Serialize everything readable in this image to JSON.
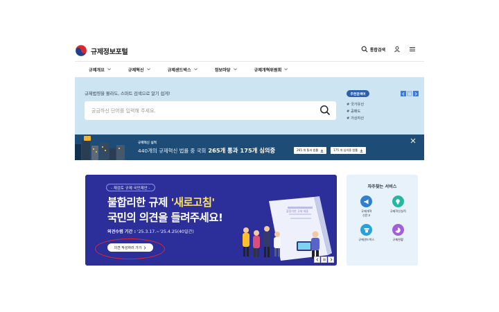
{
  "header": {
    "logo_text": "규제정보포털",
    "search_label": "통합검색"
  },
  "nav": {
    "items": [
      {
        "label": "규제개요"
      },
      {
        "label": "규제혁신"
      },
      {
        "label": "규제샌드박스"
      },
      {
        "label": "정보마당"
      },
      {
        "label": "규제개혁위원회"
      }
    ]
  },
  "hero": {
    "tagline": "규제법령을 몰라도, 스마트 검색으로 알기 쉽게!",
    "search_placeholder": "궁금하신 단어를 입력해 주세요.",
    "reco_badge": "추천검색어",
    "hashtags": [
      "# 국가유산",
      "# 공매도",
      "# 가상자산"
    ]
  },
  "stats": {
    "subtitle": "규제혁신 실적",
    "prefix": "440개의 규제혁신 법률 중 국회",
    "passed": "265개 통과",
    "pending": "175개 심의중",
    "btn_passed": "265 개 통과 법률",
    "btn_pending": "175 개 심의중 법률"
  },
  "banner": {
    "pill": "- 재검토 규제 국민제안 -",
    "line1_pre": "불합리한 규제 ",
    "line1_hl": "'새로고침'",
    "line2": "국민의 의견을 들려주세요!",
    "period_label": "의견수렴 기간 :",
    "period_value": " '25.3.17.~'25.4.25(40일간)",
    "cta": "의견 작성하러 가기",
    "art_caption": "불합리한 규제 제출"
  },
  "services": {
    "title": "자주찾는 서비스",
    "items": [
      {
        "label": "규제개혁\n신문고",
        "color": "#2f7fd3",
        "icon": "megaphone-icon"
      },
      {
        "label": "규제혁신실적",
        "color": "#23b9a0",
        "icon": "lightbulb-icon"
      },
      {
        "label": "규제샌드박스",
        "color": "#2aa0d8",
        "icon": "sandbox-icon"
      },
      {
        "label": "규제현황",
        "color": "#a35fd6",
        "icon": "chart-icon"
      }
    ]
  }
}
